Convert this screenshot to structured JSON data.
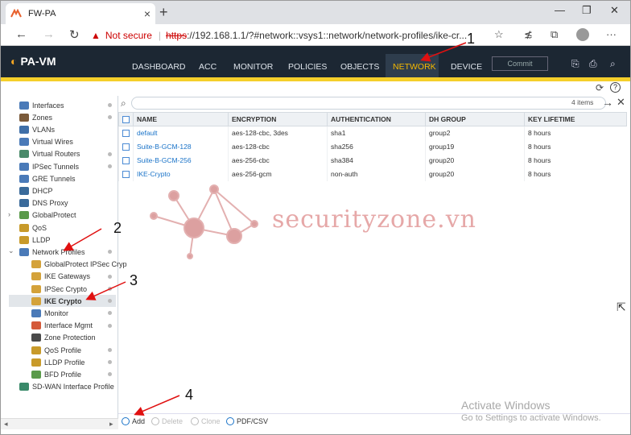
{
  "browser": {
    "tab_title": "FW-PA",
    "tab_close": "×",
    "new_tab": "+",
    "win_min": "—",
    "win_restore": "❐",
    "win_close": "✕",
    "back": "←",
    "forward": "→",
    "reload": "↻",
    "warning_icon": "▲",
    "not_secure": "Not secure",
    "separator": "|",
    "url_scheme": "https",
    "url_rest": "://192.168.1.1/?#network::vsys1::network/network-profiles/ike-cr...",
    "star": "☆",
    "favorites": "≴",
    "collections": "⧉"
  },
  "app": {
    "logo_mark": "◐",
    "logo_text": "PA-VM",
    "menu": [
      "DASHBOARD",
      "ACC",
      "MONITOR",
      "POLICIES",
      "OBJECTS",
      "NETWORK",
      "DEVICE"
    ],
    "commit": "Commit",
    "hicons": [
      "⎘",
      "⎙",
      "⌕"
    ],
    "refresh": "⟳",
    "help": "?"
  },
  "sidebar": {
    "items": [
      {
        "label": "Interfaces",
        "icon_color": "#4a7ab8"
      },
      {
        "label": "Zones",
        "icon_color": "#7a5a3a"
      },
      {
        "label": "VLANs",
        "icon_color": "#3f6fa8"
      },
      {
        "label": "Virtual Wires",
        "icon_color": "#4a7ab8"
      },
      {
        "label": "Virtual Routers",
        "icon_color": "#4a8a6a"
      },
      {
        "label": "IPSec Tunnels",
        "icon_color": "#4a7ab8"
      },
      {
        "label": "GRE Tunnels",
        "icon_color": "#4a7ab8"
      },
      {
        "label": "DHCP",
        "icon_color": "#3a6a9a"
      },
      {
        "label": "DNS Proxy",
        "icon_color": "#3a6a9a"
      },
      {
        "label": "GlobalProtect",
        "icon_color": "#5a9a4a"
      },
      {
        "label": "QoS",
        "icon_color": "#c89a2a"
      },
      {
        "label": "LLDP",
        "icon_color": "#c89a2a"
      },
      {
        "label": "Network Profiles",
        "icon_color": "#4a7ab8"
      },
      {
        "label": "GlobalProtect IPSec Cryp",
        "icon_color": "#d4a23a"
      },
      {
        "label": "IKE Gateways",
        "icon_color": "#d4a23a"
      },
      {
        "label": "IPSec Crypto",
        "icon_color": "#d4a23a"
      },
      {
        "label": "IKE Crypto",
        "icon_color": "#d4a23a"
      },
      {
        "label": "Monitor",
        "icon_color": "#4a7ab8"
      },
      {
        "label": "Interface Mgmt",
        "icon_color": "#d45a3a"
      },
      {
        "label": "Zone Protection",
        "icon_color": "#4a4a4a"
      },
      {
        "label": "QoS Profile",
        "icon_color": "#c89a2a"
      },
      {
        "label": "LLDP Profile",
        "icon_color": "#c89a2a"
      },
      {
        "label": "BFD Profile",
        "icon_color": "#5a9a4a"
      },
      {
        "label": "SD-WAN Interface Profile",
        "icon_color": "#3a8a6a"
      }
    ],
    "expander": "›",
    "collapser": "⌄"
  },
  "search": {
    "icon": "⌕",
    "count": "4 items",
    "apply": "→",
    "clear": "✕"
  },
  "table": {
    "columns": [
      "NAME",
      "ENCRYPTION",
      "AUTHENTICATION",
      "DH GROUP",
      "KEY LIFETIME"
    ],
    "rows": [
      [
        "default",
        "aes-128-cbc, 3des",
        "sha1",
        "group2",
        "8 hours"
      ],
      [
        "Suite-B-GCM-128",
        "aes-128-cbc",
        "sha256",
        "group19",
        "8 hours"
      ],
      [
        "Suite-B-GCM-256",
        "aes-256-cbc",
        "sha384",
        "group20",
        "8 hours"
      ],
      [
        "IKE-Crypto",
        "aes-256-gcm",
        "non-auth",
        "group20",
        "8 hours"
      ]
    ]
  },
  "bottom": {
    "add": "Add",
    "delete": "Delete",
    "clone": "Clone",
    "pdfcsv": "PDF/CSV"
  },
  "watermark": "securityzone.vn",
  "activate": {
    "line1": "Activate Windows",
    "line2": "Go to Settings to activate Windows."
  },
  "annotations": [
    "1",
    "2",
    "3",
    "4"
  ],
  "colors": {
    "header_bg": "#1c2733",
    "active_menu": "#f5b800",
    "accent_bar": "#f5cf2a",
    "arrow_red": "#e01010"
  }
}
